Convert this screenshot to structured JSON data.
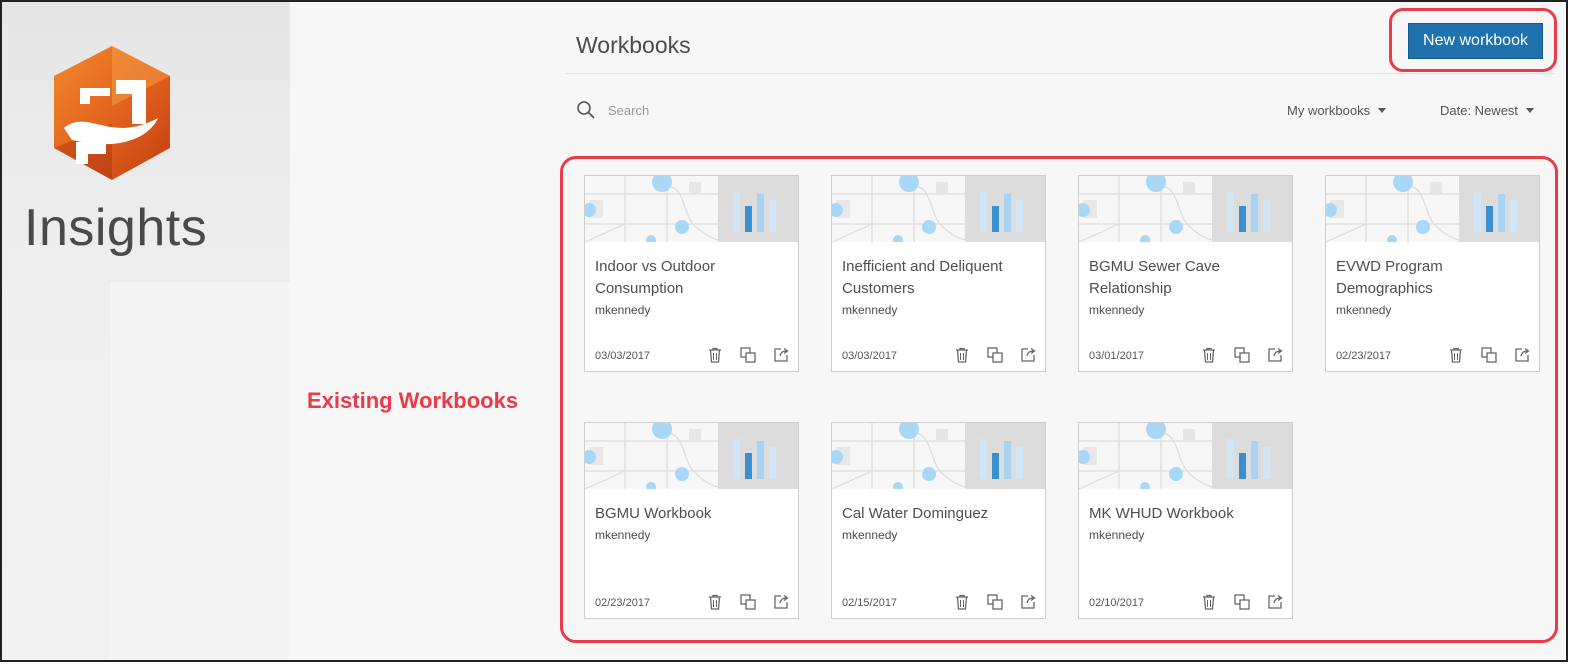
{
  "app": {
    "name": "Insights"
  },
  "header": {
    "title": "Workbooks",
    "new_button_label": "New workbook"
  },
  "search": {
    "placeholder": "Search"
  },
  "filters": {
    "owner_filter": "My workbooks",
    "sort": "Date: Newest"
  },
  "annotation": {
    "label": "Existing Workbooks"
  },
  "colors": {
    "primary_button": "#1f72ad",
    "highlight": "#ea3b48"
  },
  "workbooks": [
    {
      "title": "Indoor vs Outdoor Consumption",
      "owner": "mkennedy",
      "date": "03/03/2017"
    },
    {
      "title": "Inefficient and Deliquent Customers",
      "owner": "mkennedy",
      "date": "03/03/2017"
    },
    {
      "title": "BGMU Sewer Cave Relationship",
      "owner": "mkennedy",
      "date": "03/01/2017"
    },
    {
      "title": "EVWD Program Demographics",
      "owner": "mkennedy",
      "date": "02/23/2017"
    },
    {
      "title": "BGMU Workbook",
      "owner": "mkennedy",
      "date": "02/23/2017"
    },
    {
      "title": "Cal Water Dominguez",
      "owner": "mkennedy",
      "date": "02/15/2017"
    },
    {
      "title": "MK WHUD Workbook",
      "owner": "mkennedy",
      "date": "02/10/2017"
    }
  ],
  "icons": {
    "delete": "trash-icon",
    "duplicate": "duplicate-icon",
    "share": "share-icon",
    "search": "search-icon"
  }
}
